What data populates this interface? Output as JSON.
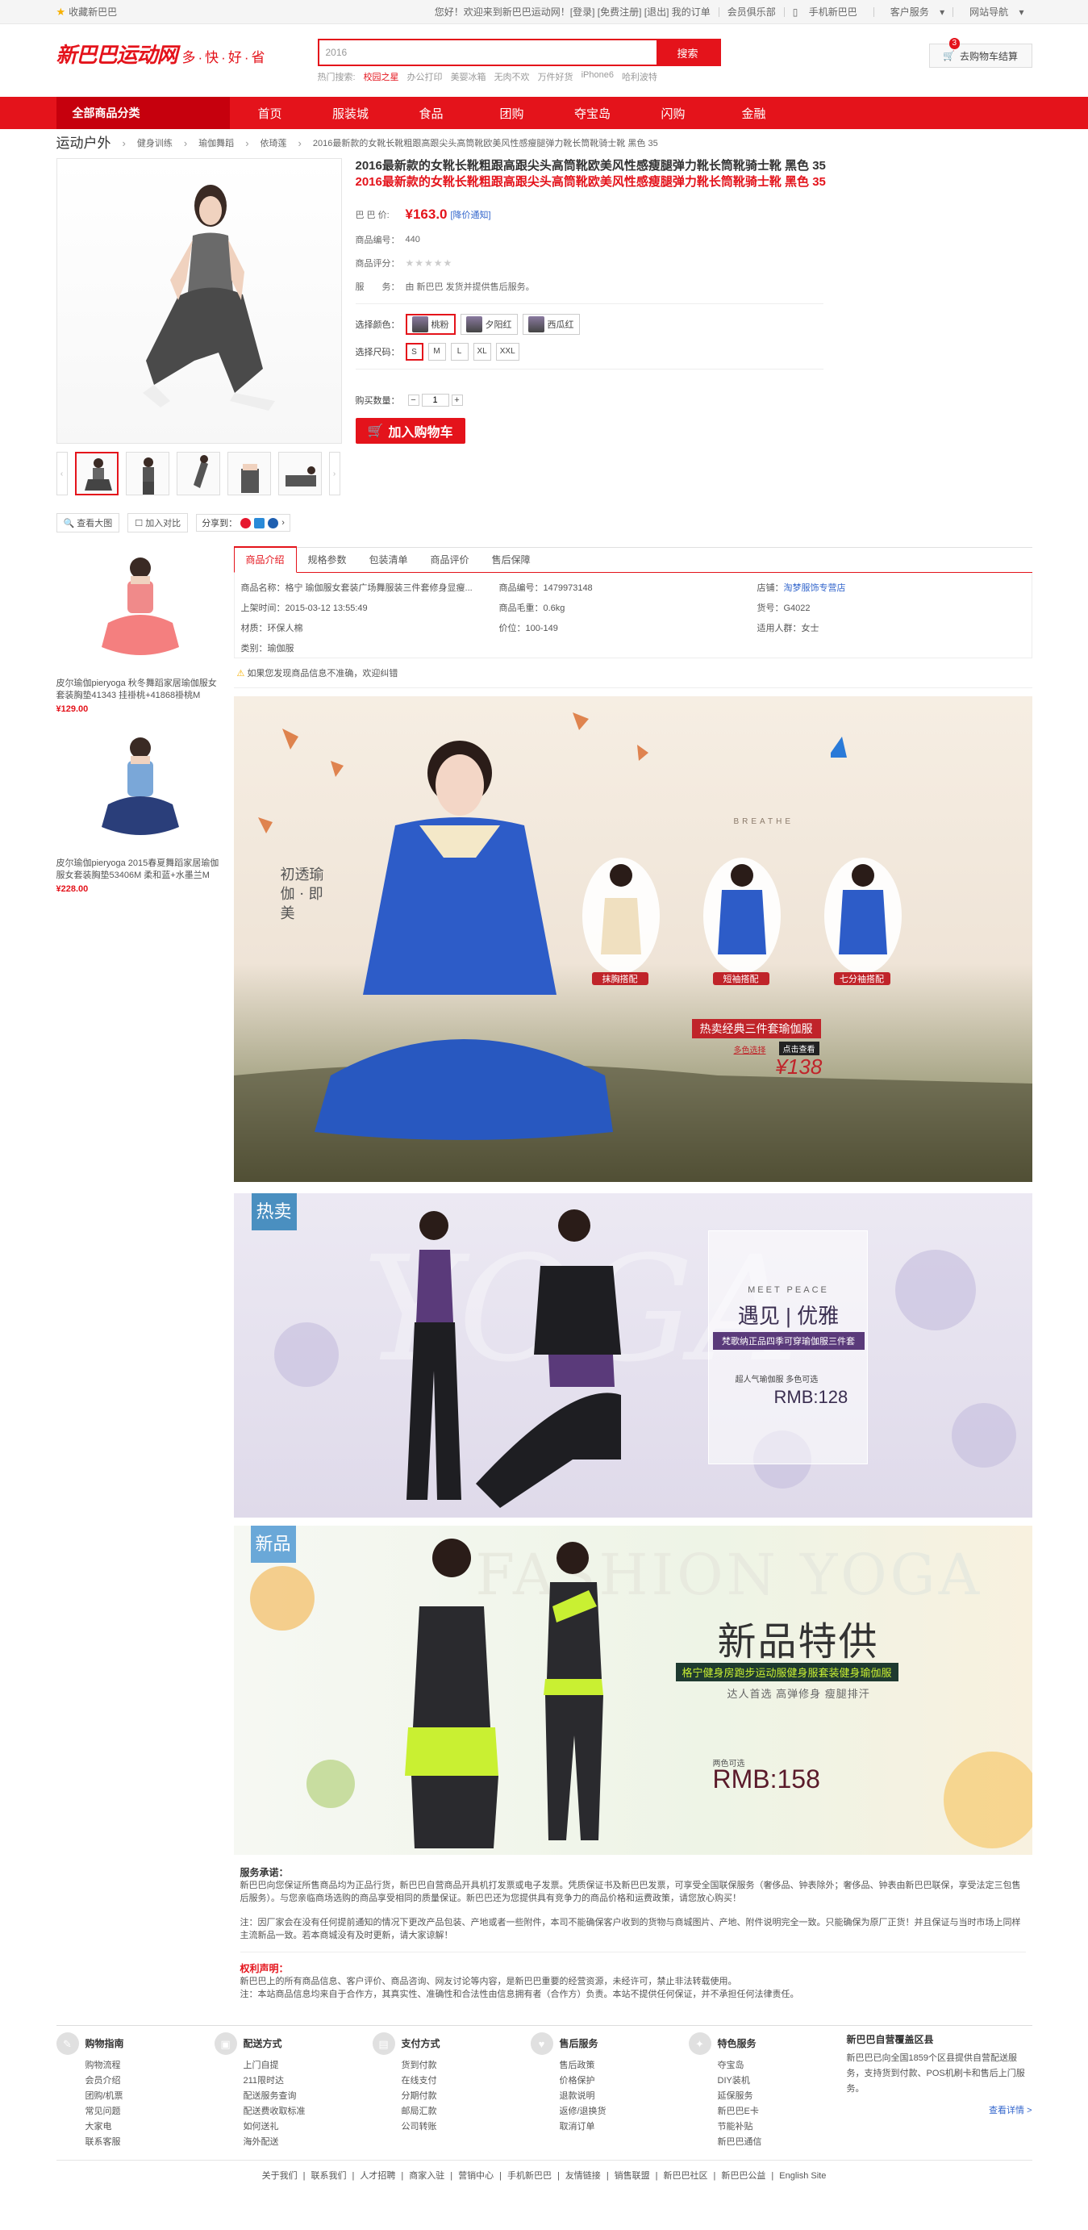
{
  "topbar": {
    "fav": "收藏新巴巴",
    "welcome": "您好！欢迎来到新巴巴运动网！[登录] [免费注册] [退出] 我的订单",
    "vip": "会员俱乐部",
    "mobile": "手机新巴巴",
    "service": "客户服务",
    "sitenav": "网站导航"
  },
  "logo": {
    "name": "新巴巴运动网",
    "slogan": "多·快·好·省"
  },
  "search": {
    "value": "2016",
    "button": "搜索",
    "hot_label": "热门搜索:",
    "hot": [
      "校园之星",
      "办公打印",
      "美婴冰箱",
      "无肉不欢",
      "万件好货",
      "iPhone6",
      "哈利波特"
    ]
  },
  "cart": {
    "count": "3",
    "label": "去购物车结算"
  },
  "nav": {
    "all": "全部商品分类",
    "items": [
      "首页",
      "服装城",
      "食品",
      "团购",
      "夺宝岛",
      "闪购",
      "金融"
    ]
  },
  "crumb": [
    "运动户外",
    "健身训练",
    "瑜伽舞蹈",
    "依琦莲",
    "2016最新款的女靴长靴粗跟高跟尖头高筒靴欧美风性感瘦腿弹力靴长筒靴骑士靴 黑色 35"
  ],
  "product": {
    "title": "2016最新款的女靴长靴粗跟高跟尖头高筒靴欧美风性感瘦腿弹力靴长筒靴骑士靴 黑色 35",
    "subtitle": "2016最新款的女靴长靴粗跟高跟尖头高筒靴欧美风性感瘦腿弹力靴长筒靴骑士靴 黑色 35",
    "price_label": "巴 巴 价:",
    "price": "¥163.0",
    "notice": "[降价通知]",
    "sn_label": "商品编号：",
    "sn": "440",
    "score_label": "商品评分：",
    "serve_label": "服　　务：",
    "serve": "由 新巴巴 发货并提供售后服务。",
    "color_label": "选择颜色：",
    "colors": [
      "桃粉",
      "夕阳红",
      "西瓜红"
    ],
    "size_label": "选择尺码：",
    "sizes": [
      "S",
      "M",
      "L",
      "XL",
      "XXL"
    ],
    "qty_label": "购买数量：",
    "qty": "1",
    "addcart": "加入购物车"
  },
  "gallery": {
    "view": "查看大图",
    "compare": "加入对比",
    "share": "分享到："
  },
  "side": [
    {
      "name": "皮尔瑜伽pieryoga 秋冬舞蹈家居瑜伽服女套装胸垫41343 挂褂桃+41868褂桃M",
      "price": "¥129.00"
    },
    {
      "name": "皮尔瑜伽pieryoga 2015春夏舞蹈家居瑜伽服女套装胸垫53406M 柔和蓝+水墨兰M",
      "price": "¥228.00"
    }
  ],
  "tabs": [
    "商品介绍",
    "规格参数",
    "包装清单",
    "商品评价",
    "售后保障"
  ],
  "spec": [
    "商品名称：格宁 瑜伽服女套装广场舞服装三件套修身显瘦...",
    "商品编号：1479973148",
    "店铺：淘梦服饰专营店",
    "上架时间：2015-03-12 13:55:49",
    "商品毛重：0.6kg",
    "货号：G4022",
    "材质：环保人棉",
    "价位：100-149",
    "适用人群：女士",
    "类别：瑜伽服"
  ],
  "warn": "如果您发现商品信息不准确，欢迎纠错",
  "banner1": {
    "breathe": "BREATHE",
    "poem": "初透瑜伽 · 即美",
    "tags": [
      "抹胸搭配",
      "短袖搭配",
      "七分袖搭配"
    ],
    "promo": "热卖经典三件套瑜伽服",
    "color": "多色选择",
    "look": "点击查看",
    "price": "¥138"
  },
  "banner2": {
    "tag": "热卖",
    "meet": "MEET PEACE",
    "title": "遇见 | 优雅",
    "sub": "梵歌纳正品四季可穿瑜伽服三件套",
    "pop": "超人气瑜伽服 多色可选",
    "price": "RMB:128",
    "bg": "YOGA"
  },
  "banner3": {
    "tag": "新品",
    "bg": "FASHION YOGA",
    "title": "新品特供",
    "sub": "格宁健身房跑步运动服健身服套装健身瑜伽服",
    "sub2": "达人首选 高弹修身 瘦腿排汗",
    "plabel": "两色可选",
    "price": "RMB:158"
  },
  "service": {
    "h1": "服务承诺：",
    "p1": "新巴巴向您保证所售商品均为正品行货，新巴巴自营商品开具机打发票或电子发票。凭质保证书及新巴巴发票，可享受全国联保服务（奢侈品、钟表除外；奢侈品、钟表由新巴巴联保，享受法定三包售后服务）。与您亲临商场选购的商品享受相同的质量保证。新巴巴还为您提供具有竞争力的商品价格和运费政策，请您放心购买！",
    "p2": "注：因厂家会在没有任何提前通知的情况下更改产品包装、产地或者一些附件，本司不能确保客户收到的货物与商城图片、产地、附件说明完全一致。只能确保为原厂正货！并且保证与当时市场上同样主流新品一致。若本商城没有及时更新，请大家谅解！",
    "h2": "权利声明：",
    "p3": "新巴巴上的所有商品信息、客户评价、商品咨询、网友讨论等内容，是新巴巴重要的经营资源，未经许可，禁止非法转载使用。",
    "p4": "注：本站商品信息均来自于合作方，其真实性、准确性和合法性由信息拥有者（合作方）负责。本站不提供任何保证，并不承担任何法律责任。"
  },
  "footer": {
    "cols": [
      {
        "h": "购物指南",
        "items": [
          "购物流程",
          "会员介绍",
          "团购/机票",
          "常见问题",
          "大家电",
          "联系客服"
        ]
      },
      {
        "h": "配送方式",
        "items": [
          "上门自提",
          "211限时达",
          "配送服务查询",
          "配送费收取标准",
          "如何送礼",
          "海外配送"
        ]
      },
      {
        "h": "支付方式",
        "items": [
          "货到付款",
          "在线支付",
          "分期付款",
          "邮局汇款",
          "公司转账"
        ]
      },
      {
        "h": "售后服务",
        "items": [
          "售后政策",
          "价格保护",
          "退款说明",
          "返修/退换货",
          "取消订单"
        ]
      },
      {
        "h": "特色服务",
        "items": [
          "夺宝岛",
          "DIY装机",
          "延保服务",
          "新巴巴E卡",
          "节能补贴",
          "新巴巴通信"
        ]
      }
    ],
    "store_h": "新巴巴自营覆盖区县",
    "store": "新巴巴已向全国1859个区县提供自营配送服务，支持货到付款、POS机刷卡和售后上门服务。",
    "more": "查看详情 >",
    "links": [
      "关于我们",
      "联系我们",
      "人才招聘",
      "商家入驻",
      "营销中心",
      "手机新巴巴",
      "友情链接",
      "销售联盟",
      "新巴巴社区",
      "新巴巴公益",
      "English Site"
    ]
  },
  "colors": {
    "brand": "#e4131b",
    "link": "#3366cc"
  }
}
